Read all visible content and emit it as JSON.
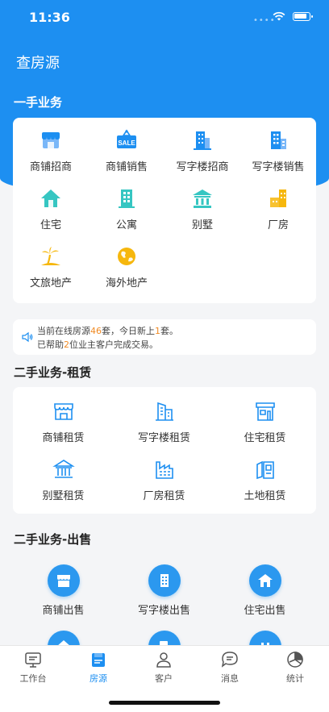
{
  "status_bar": {
    "time": "11:36",
    "dots": "••••"
  },
  "page_title": "查房源",
  "section1": {
    "title": "一手业务",
    "items": [
      {
        "label": "商铺招商",
        "icon": "storefront-icon"
      },
      {
        "label": "商铺销售",
        "icon": "sale-sign-icon",
        "sign_text": "SALE"
      },
      {
        "label": "写字楼招商",
        "icon": "office-tower-icon"
      },
      {
        "label": "写字楼销售",
        "icon": "office-building-icon"
      },
      {
        "label": "住宅",
        "icon": "house-icon"
      },
      {
        "label": "公寓",
        "icon": "apartment-icon"
      },
      {
        "label": "别墅",
        "icon": "villa-icon"
      },
      {
        "label": "厂房",
        "icon": "factory-icon"
      },
      {
        "label": "文旅地产",
        "icon": "palm-island-icon"
      },
      {
        "label": "海外地产",
        "icon": "globe-icon"
      }
    ]
  },
  "notice": {
    "l1_a": "当前在线房源",
    "l1_count": "46",
    "l1_b": "套，今日新上",
    "l1_new": "1",
    "l1_c": "套。",
    "l2_a": "已帮助",
    "l2_count": "2",
    "l2_b": "位业主客户完成交易。"
  },
  "section2": {
    "title": "二手业务-租赁",
    "items": [
      {
        "label": "商铺租赁",
        "icon": "storefront-outline-icon"
      },
      {
        "label": "写字楼租赁",
        "icon": "office-outline-icon"
      },
      {
        "label": "住宅租赁",
        "icon": "residence-outline-icon"
      },
      {
        "label": "别墅租赁",
        "icon": "villa-outline-icon"
      },
      {
        "label": "厂房租赁",
        "icon": "factory-outline-icon"
      },
      {
        "label": "土地租赁",
        "icon": "land-outline-icon"
      }
    ]
  },
  "section3": {
    "title": "二手业务-出售",
    "items": [
      {
        "label": "商铺出售",
        "icon": "storefront-circle-icon"
      },
      {
        "label": "写字楼出售",
        "icon": "office-circle-icon"
      },
      {
        "label": "住宅出售",
        "icon": "residence-circle-icon"
      },
      {
        "label": "",
        "icon": "villa-circle-icon"
      },
      {
        "label": "",
        "icon": "factory-circle-icon"
      },
      {
        "label": "",
        "icon": "land-circle-icon"
      }
    ]
  },
  "tabbar": {
    "active": "房源",
    "items": [
      {
        "label": "工作台",
        "icon": "workbench-icon"
      },
      {
        "label": "房源",
        "icon": "listings-icon"
      },
      {
        "label": "客户",
        "icon": "customer-icon"
      },
      {
        "label": "消息",
        "icon": "message-icon"
      },
      {
        "label": "统计",
        "icon": "stats-icon"
      }
    ]
  },
  "colors": {
    "primary": "#1d8ff1",
    "highlight": "#f08a24",
    "background": "#f4f5f7",
    "teal": "#36c6c2",
    "yellow": "#f6b70d"
  }
}
